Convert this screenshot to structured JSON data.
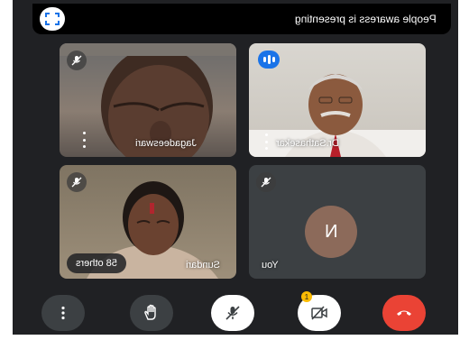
{
  "colors": {
    "background": "#202124",
    "tile": "#3c4043",
    "end_call": "#ea4335",
    "speaking": "#1a73e8",
    "notification": "#fbbc04"
  },
  "presenting_banner": {
    "text": "People awaress is presenting",
    "icon": "fullscreen-icon"
  },
  "tiles": [
    {
      "name": "Jagadeeswari",
      "muted": true,
      "icon": "mic-off-icon"
    },
    {
      "name": "Dr.Sathasekar",
      "muted": false,
      "speaking": true,
      "icon": "audio-level-icon"
    },
    {
      "name": "Sundari",
      "muted": true,
      "icon": "mic-off-icon"
    },
    {
      "name": "You",
      "muted": true,
      "avatar_initial": "N",
      "icon": "mic-off-icon"
    }
  ],
  "others_chip": {
    "label": "58 others"
  },
  "controls": [
    {
      "name": "more-options",
      "icon": "more-vert-icon"
    },
    {
      "name": "raise-hand",
      "icon": "hand-icon"
    },
    {
      "name": "microphone",
      "icon": "mic-off-icon",
      "state": "off"
    },
    {
      "name": "camera",
      "icon": "camera-off-icon",
      "state": "off",
      "notification_count": "1"
    },
    {
      "name": "end-call",
      "icon": "phone-hangup-icon"
    }
  ]
}
